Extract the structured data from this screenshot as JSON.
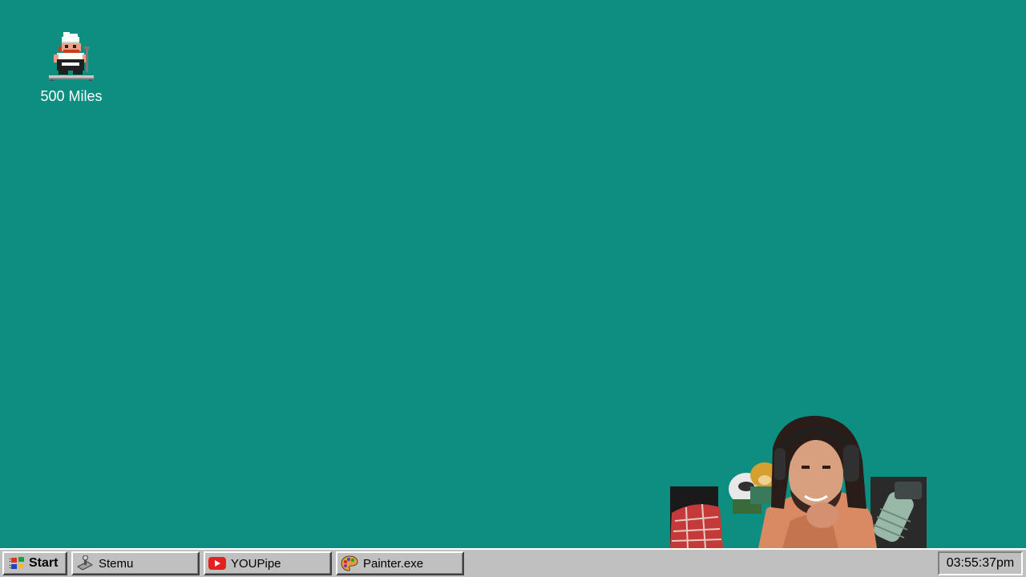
{
  "desktop": {
    "background_color": "#0d8e80",
    "icons": [
      {
        "label": "500 Miles",
        "icon": "pixel-chef-character-icon"
      }
    ],
    "webcam_overlay": {
      "content": "streamer with headphones and plush toys"
    }
  },
  "taskbar": {
    "start": {
      "label": "Start",
      "icon": "windows-flag-icon"
    },
    "tasks": [
      {
        "label": "Stemu",
        "icon": "joystick-icon"
      },
      {
        "label": "YOUPipe",
        "icon": "play-button-icon",
        "accent": "#e52020"
      },
      {
        "label": "Painter.exe",
        "icon": "paint-palette-icon"
      }
    ],
    "clock": "03:55:37pm"
  }
}
